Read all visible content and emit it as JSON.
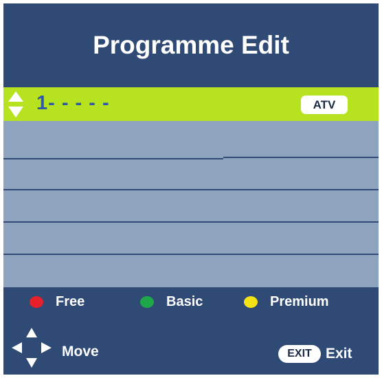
{
  "header": {
    "title": "Programme Edit"
  },
  "list": {
    "selected": {
      "number": "1- - - - -",
      "type_badge": "ATV"
    },
    "rows": [
      "",
      "",
      "",
      "",
      ""
    ]
  },
  "legend": {
    "items": [
      {
        "label": "Free",
        "color": "#e8202a"
      },
      {
        "label": "Basic",
        "color": "#1fa84a"
      },
      {
        "label": "Premium",
        "color": "#f4e416"
      }
    ]
  },
  "footer": {
    "move_label": "Move",
    "exit_key": "EXIT",
    "exit_label": "Exit",
    "move_icon": "dpad-arrows-icon"
  },
  "colors": {
    "background": "#2f4a74",
    "selected_row": "#b6e21f",
    "list_rows": "#8ea3be",
    "selected_text": "#2f58a8"
  }
}
